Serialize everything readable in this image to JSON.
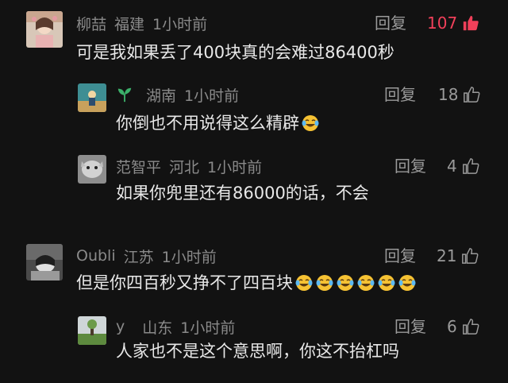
{
  "comments": [
    {
      "name": "柳喆",
      "region": "福建",
      "time": "1小时前",
      "text": "可是我如果丢了400块真的会难过86400秒",
      "reply": "回复",
      "likes": "107",
      "hot": true
    },
    {
      "name": "",
      "region": "湖南",
      "time": "1小时前",
      "text": "你倒也不用说得这么精辟",
      "reply": "回复",
      "likes": "18",
      "emoji_count": 1
    },
    {
      "name": "范智平",
      "region": "河北",
      "time": "1小时前",
      "text": "如果你兜里还有86000的话，不会",
      "reply": "回复",
      "likes": "4"
    },
    {
      "name": "Oubli",
      "region": "江苏",
      "time": "1小时前",
      "text": "但是你四百秒又挣不了四百块",
      "reply": "回复",
      "likes": "21",
      "emoji_count": 6
    },
    {
      "name": "y",
      "region": "山东",
      "time": "1小时前",
      "text": "人家也不是这个意思啊，你这不抬杠吗",
      "reply": "回复",
      "likes": "6"
    }
  ],
  "icons": {
    "like": "thumbs-up-icon",
    "like_filled": "thumbs-up-filled-icon",
    "leaf": "leaf-icon",
    "emoji": "laughing-crying-face-icon"
  },
  "colors": {
    "background": "#121212",
    "meta": "#8a8a8a",
    "text": "#e8e8e8",
    "hot_like": "#f0405a"
  }
}
